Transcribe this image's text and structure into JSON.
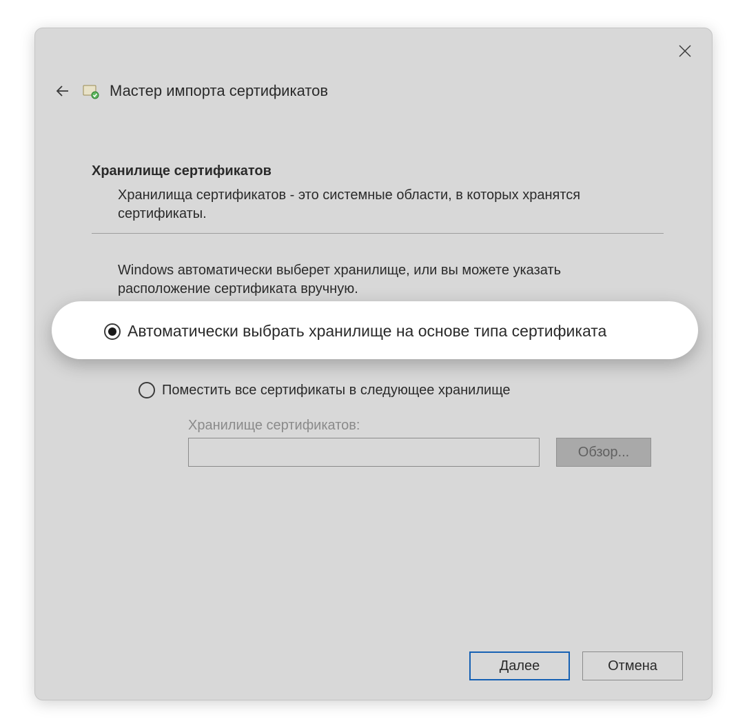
{
  "window": {
    "title": "Мастер импорта сертификатов"
  },
  "section": {
    "heading": "Хранилище сертификатов",
    "description": "Хранилища сертификатов - это системные области, в которых хранятся сертификаты.",
    "instruction": "Windows автоматически выберет хранилище, или вы можете указать расположение сертификата вручную."
  },
  "options": {
    "auto": {
      "label": "Автоматически выбрать хранилище на основе типа сертификата",
      "selected": true
    },
    "manual": {
      "label": "Поместить все сертификаты в следующее хранилище",
      "selected": false
    }
  },
  "store": {
    "label": "Хранилище сертификатов:",
    "value": "",
    "browse_label": "Обзор..."
  },
  "buttons": {
    "next": "Далее",
    "cancel": "Отмена"
  }
}
